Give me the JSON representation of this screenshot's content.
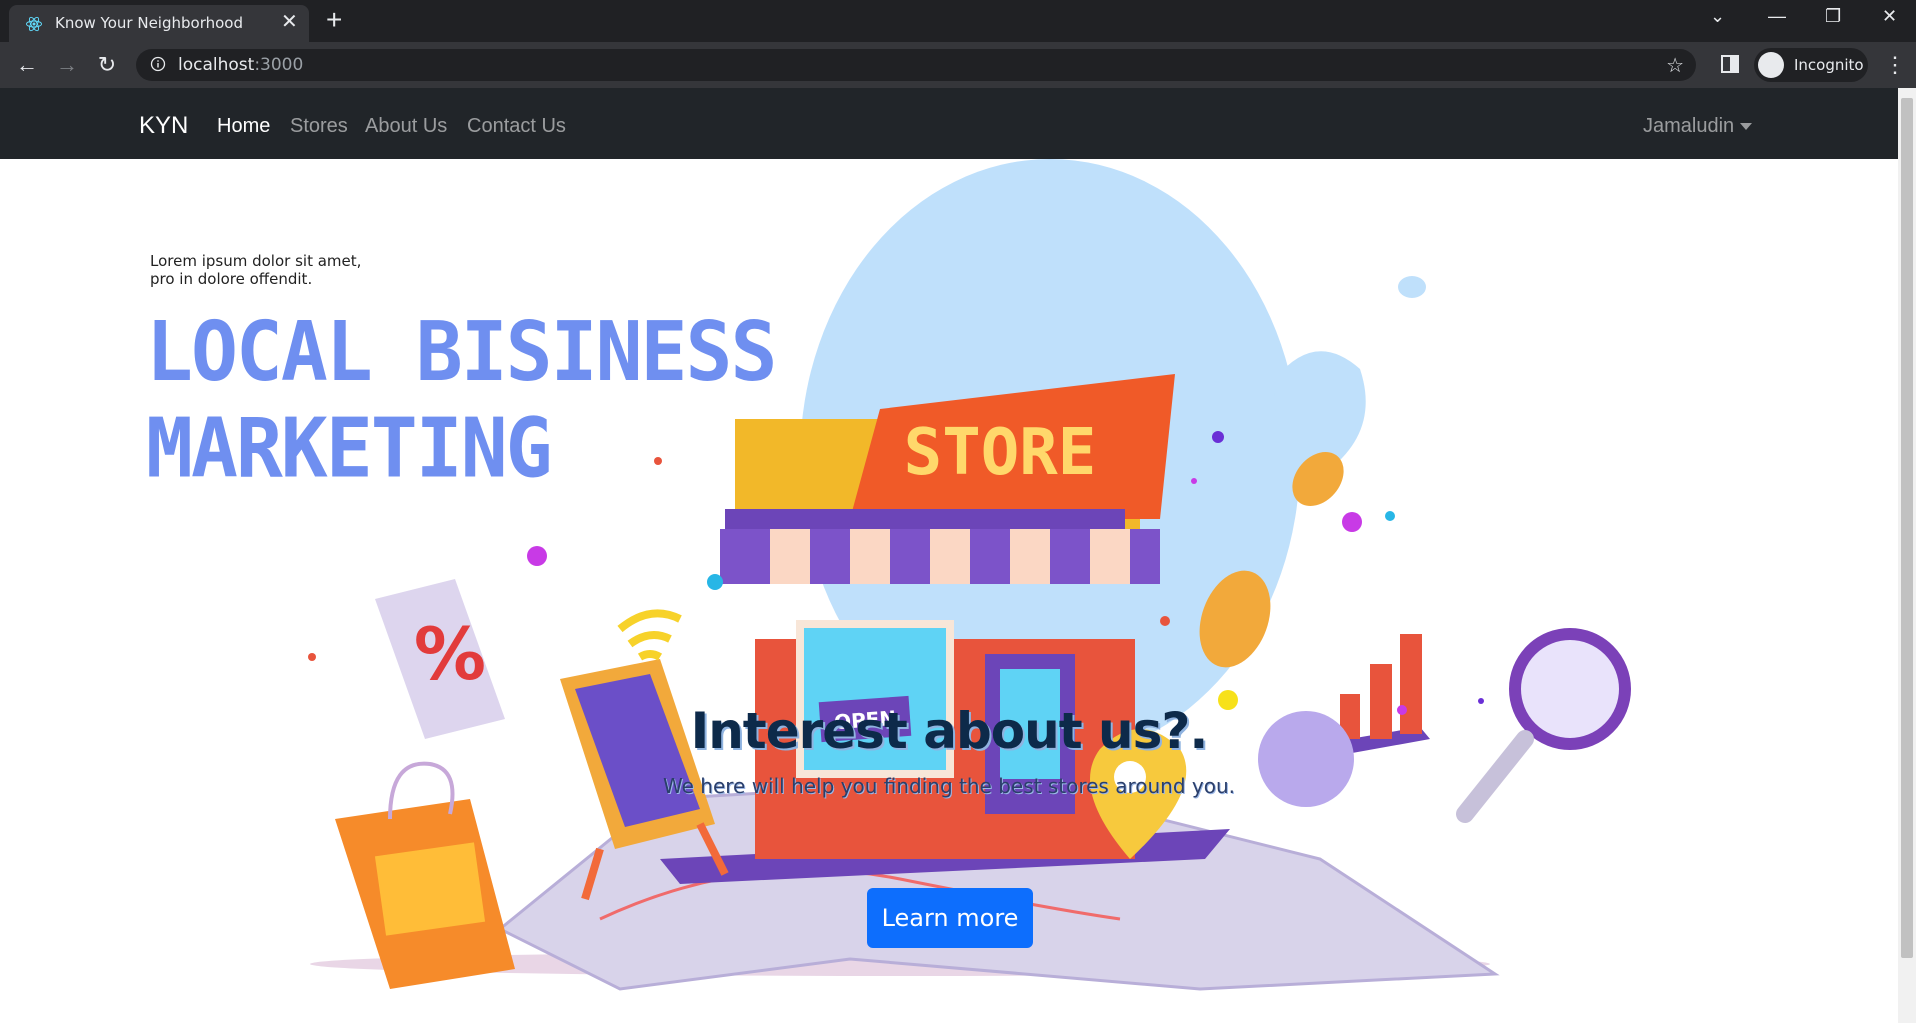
{
  "browser": {
    "tab_title": "Know Your Neighborhood",
    "url_host": "localhost",
    "url_port": ":3000",
    "profile_label": "Incognito"
  },
  "navbar": {
    "brand": "KYN",
    "links": [
      {
        "label": "Home",
        "active": true
      },
      {
        "label": "Stores",
        "active": false
      },
      {
        "label": "About Us",
        "active": false
      },
      {
        "label": "Contact Us",
        "active": false
      }
    ],
    "user": "Jamaludin"
  },
  "hero": {
    "image_text": {
      "lorem_line1": "Lorem ipsum dolor sit amet,",
      "lorem_line2": "pro in dolore offendit.",
      "title_line1": "LOCAL BISINESS",
      "title_line2": "MARKETING",
      "store_sign": "STORE",
      "open_sign": "OPEN"
    },
    "headline": "Interest about us?.",
    "subline": "We here will help you finding the best stores around you.",
    "cta": "Learn more"
  },
  "colors": {
    "navbar_bg": "#212529",
    "primary": "#0d6efd",
    "title_blue": "#6f8ff0"
  }
}
